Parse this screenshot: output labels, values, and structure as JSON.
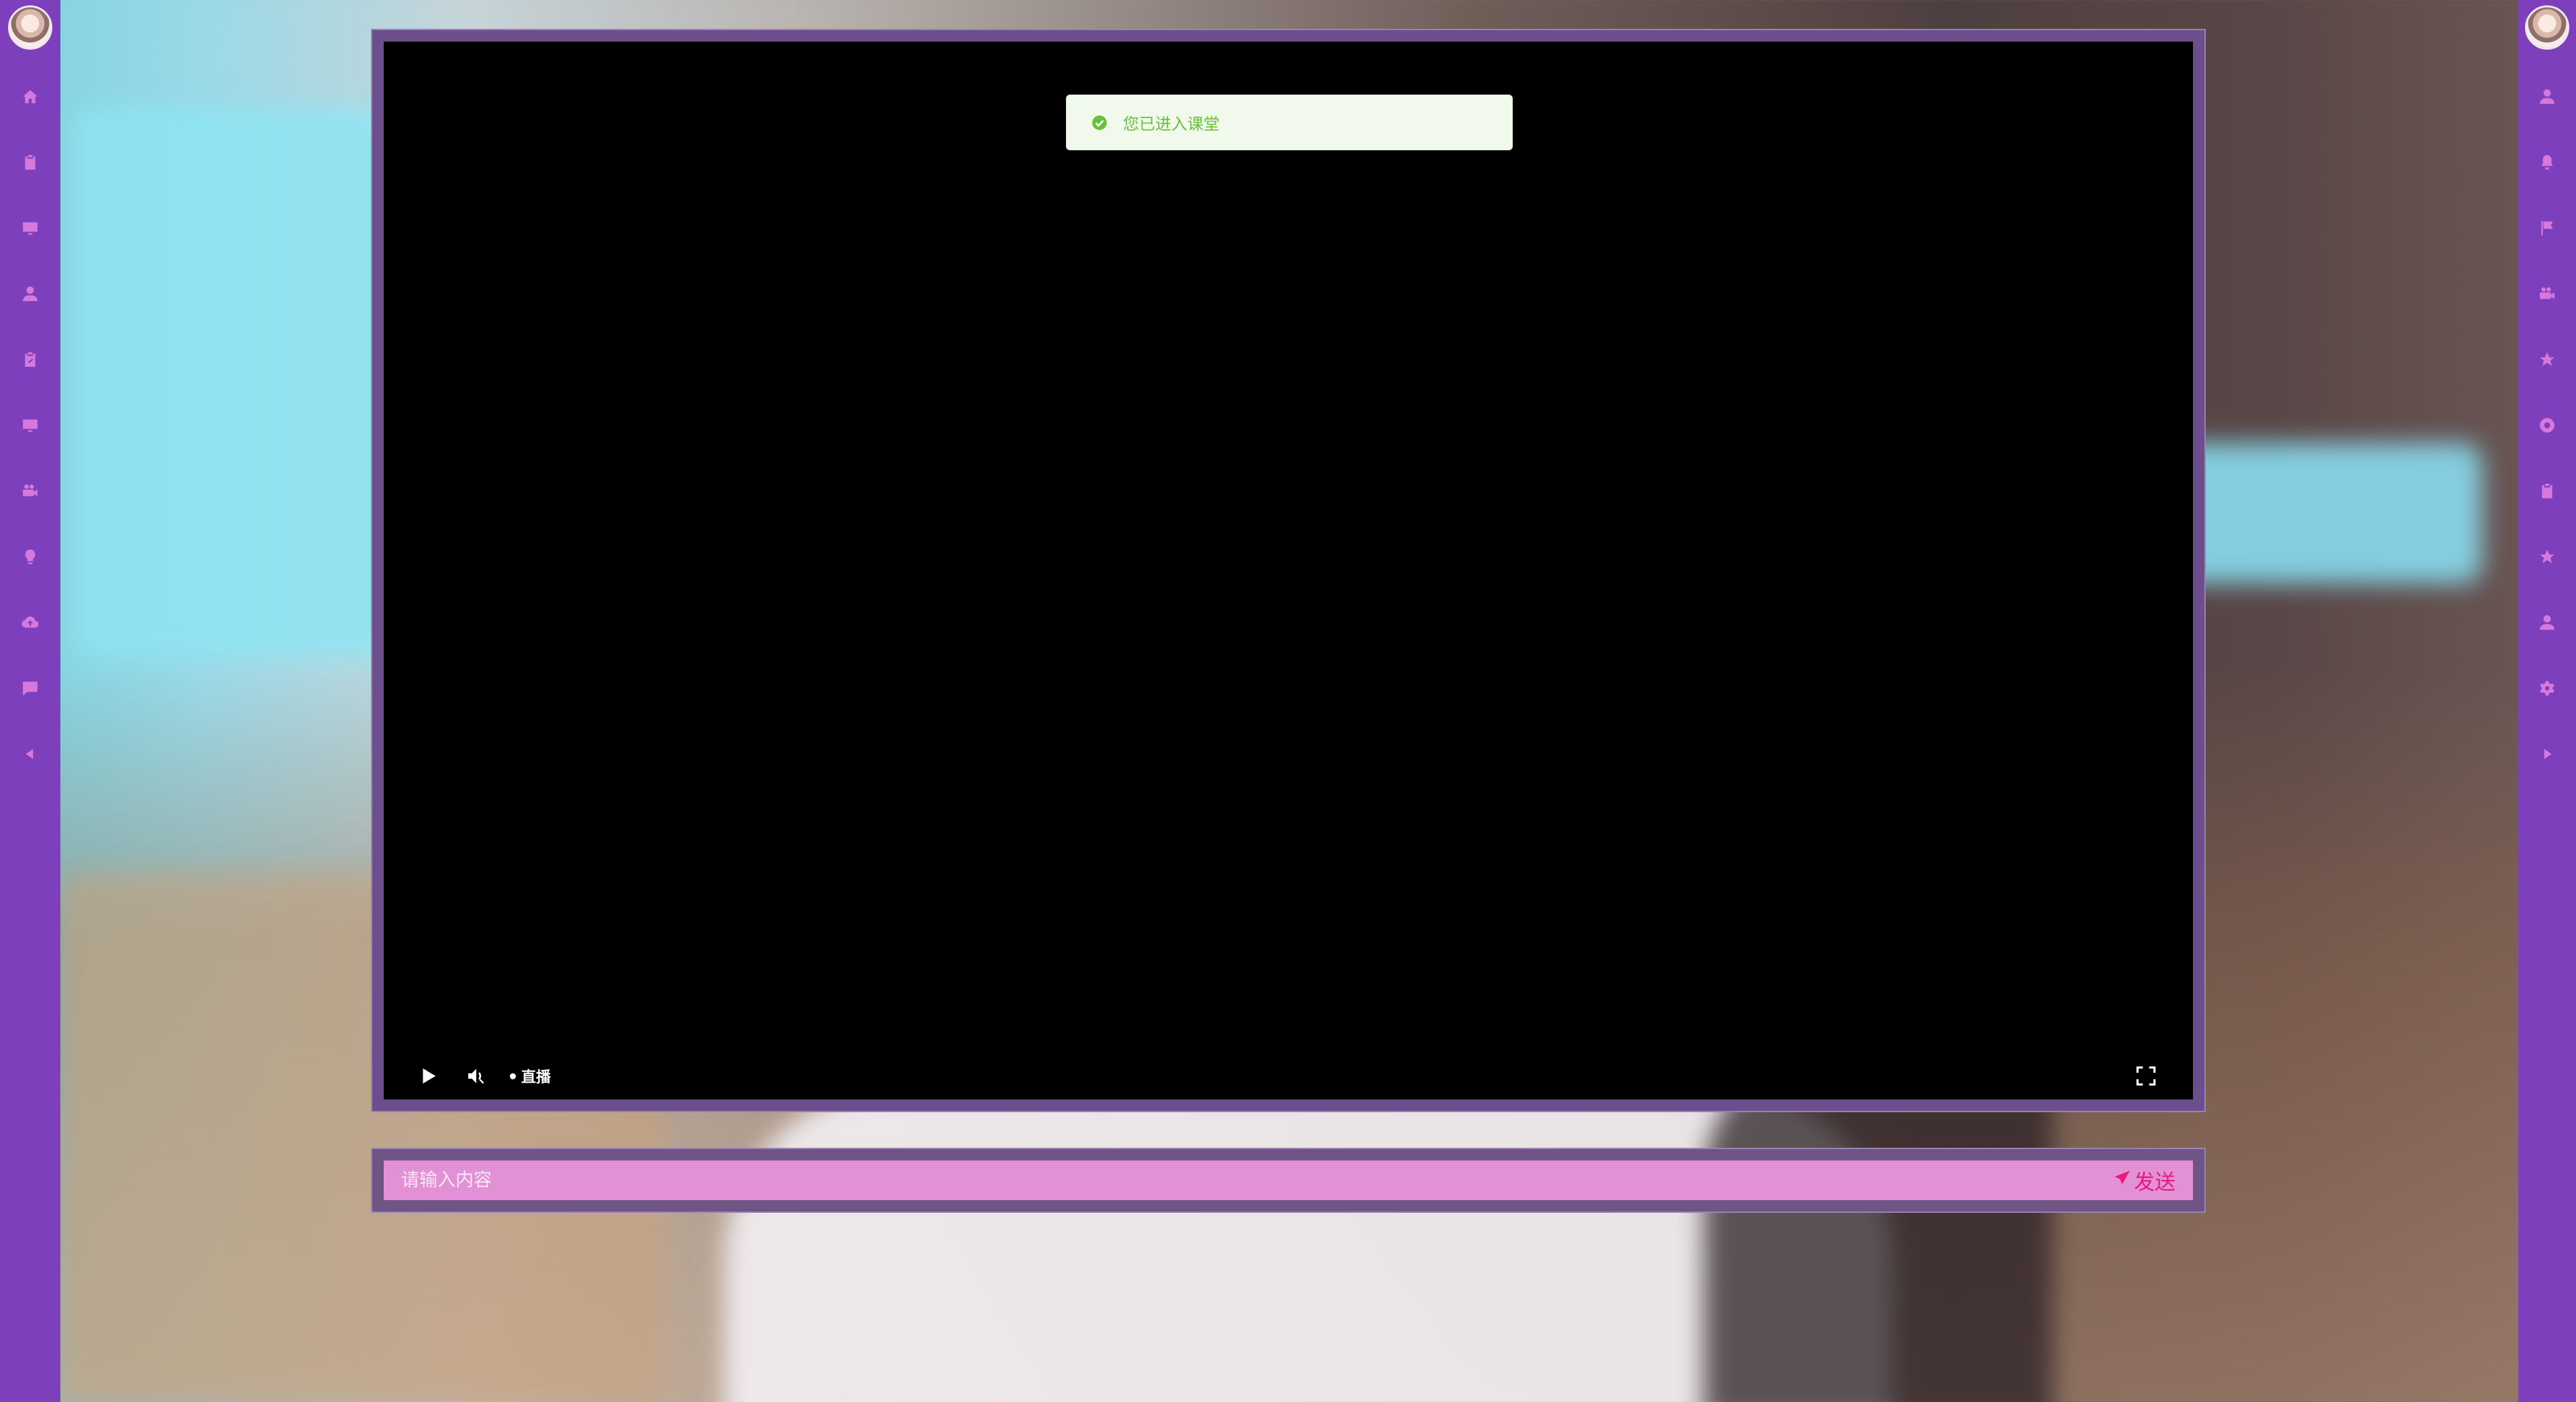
{
  "toast": {
    "message": "您已进入课堂",
    "icon": "check-circle-icon",
    "color": "#67c23a"
  },
  "player": {
    "live_label": "直播",
    "icons": [
      "play-icon",
      "volume-icon",
      "fullscreen-icon"
    ]
  },
  "chat": {
    "placeholder": "请输入内容",
    "send_label": "发送",
    "send_icon": "paper-plane-icon"
  },
  "sidebar_left": {
    "items": [
      "home-icon",
      "clipboard-icon",
      "monitor-icon",
      "user-icon",
      "checklist-icon",
      "desktop-icon",
      "video-camera-icon",
      "lightbulb-icon",
      "cloud-upload-icon",
      "chat-icon",
      "collapse-left-icon"
    ]
  },
  "sidebar_right": {
    "items": [
      "user-icon",
      "bell-icon",
      "flag-icon",
      "video-camera-icon",
      "star-icon",
      "lifebuoy-icon",
      "clipboard-icon",
      "star-icon",
      "user-icon",
      "gear-icon",
      "collapse-right-icon"
    ]
  },
  "colors": {
    "sidebar": "#7e3fbd",
    "sidebar_icon": "#d778dd",
    "chat_bar": "#e291d6",
    "send_text": "#e8197a"
  }
}
